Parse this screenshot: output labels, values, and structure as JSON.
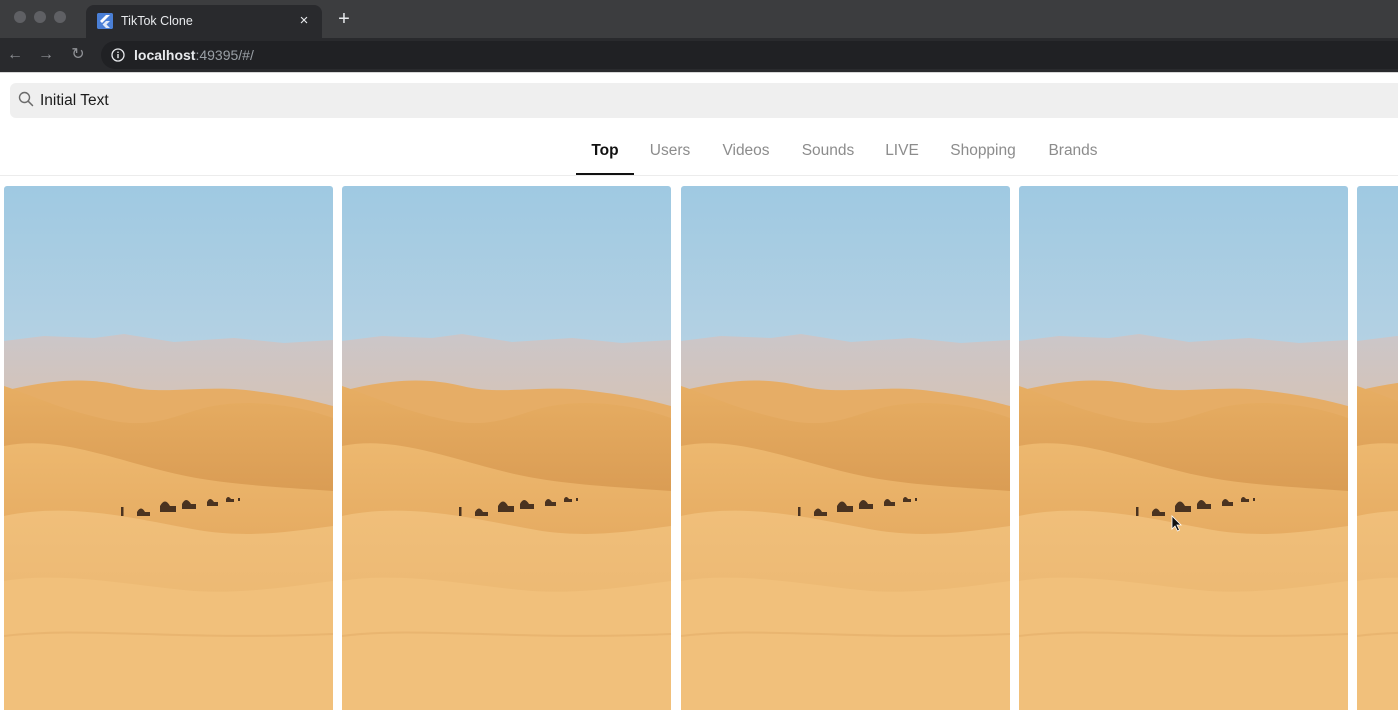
{
  "browser": {
    "tab_title": "TikTok Clone",
    "tab_close_glyph": "×",
    "new_tab_glyph": "+",
    "nav_back_glyph": "←",
    "nav_forward_glyph": "→",
    "nav_reload_glyph": "↻",
    "url_host": "localhost",
    "url_rest": ":49395/#/",
    "favicon_icon": "flutter-logo-icon"
  },
  "search": {
    "value": "Initial Text",
    "icon": "search-icon"
  },
  "tabs": [
    {
      "label": "Top",
      "active": true
    },
    {
      "label": "Users",
      "active": false
    },
    {
      "label": "Videos",
      "active": false
    },
    {
      "label": "Sounds",
      "active": false
    },
    {
      "label": "LIVE",
      "active": false
    },
    {
      "label": "Shopping",
      "active": false
    },
    {
      "label": "Brands",
      "active": false
    }
  ],
  "grid": {
    "thumbnail_subject": "desert-caravan-thumbnail",
    "card_count": 5
  },
  "colors": {
    "chrome_dark": "#292a2d",
    "tabstrip": "#3c3d3f",
    "active_tab_text": "#111111",
    "inactive_tab_text": "#8c8c8c",
    "search_bg": "#efefef",
    "sky_top": "#9fc9e2",
    "sand": "#e9b26c"
  }
}
